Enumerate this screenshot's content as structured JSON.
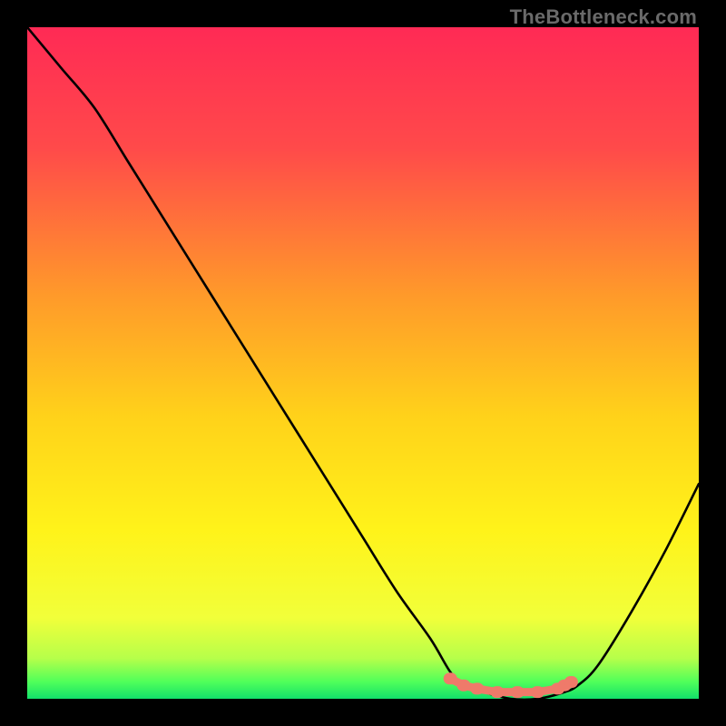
{
  "watermark": "TheBottleneck.com",
  "chart_data": {
    "type": "line",
    "title": "",
    "xlabel": "",
    "ylabel": "",
    "xlim": [
      0,
      100
    ],
    "ylim": [
      0,
      100
    ],
    "grid": false,
    "series": [
      {
        "name": "bottleneck-curve",
        "x": [
          0,
          5,
          10,
          15,
          20,
          25,
          30,
          35,
          40,
          45,
          50,
          55,
          60,
          63,
          65,
          68,
          72,
          76,
          80,
          82,
          85,
          90,
          95,
          100
        ],
        "y": [
          100,
          94,
          88,
          80,
          72,
          64,
          56,
          48,
          40,
          32,
          24,
          16,
          9,
          4,
          2,
          1,
          0,
          0,
          1,
          2,
          5,
          13,
          22,
          32
        ]
      }
    ],
    "markers": {
      "name": "optimal-range",
      "x": [
        63,
        65,
        67,
        70,
        73,
        76,
        79,
        80,
        81
      ],
      "y": [
        3,
        2,
        1.5,
        1,
        1,
        1,
        1.5,
        2,
        2.5
      ]
    },
    "gradient_stops": [
      {
        "pos": 0.0,
        "color": "#ff2a55"
      },
      {
        "pos": 0.18,
        "color": "#ff4a4a"
      },
      {
        "pos": 0.4,
        "color": "#ff9a2a"
      },
      {
        "pos": 0.58,
        "color": "#ffd21a"
      },
      {
        "pos": 0.75,
        "color": "#fff31a"
      },
      {
        "pos": 0.88,
        "color": "#f1ff3a"
      },
      {
        "pos": 0.94,
        "color": "#b6ff4a"
      },
      {
        "pos": 0.975,
        "color": "#4fff5a"
      },
      {
        "pos": 1.0,
        "color": "#12e06a"
      }
    ]
  }
}
